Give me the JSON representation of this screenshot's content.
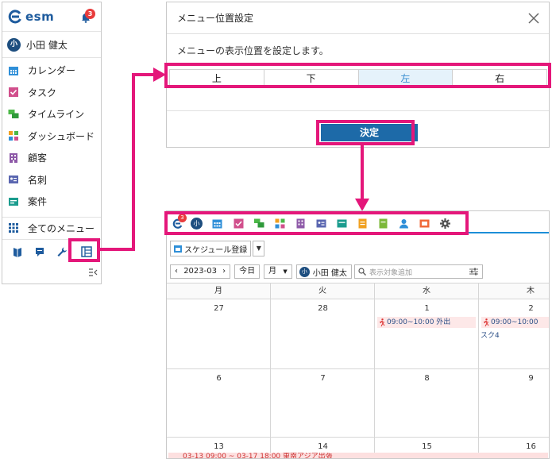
{
  "sidebar": {
    "logo": "esm",
    "notification_count": "3",
    "user": {
      "initial": "小",
      "name": "小田 健太"
    },
    "items": [
      {
        "label": "カレンダー",
        "icon": "calendar-icon",
        "color": "#2f8fd8"
      },
      {
        "label": "タスク",
        "icon": "task-icon",
        "color": "#d14f8c"
      },
      {
        "label": "タイムライン",
        "icon": "timeline-icon",
        "color": "#4cb848"
      },
      {
        "label": "ダッシュボード",
        "icon": "dashboard-icon",
        "color": "#f0a020"
      },
      {
        "label": "顧客",
        "icon": "customer-icon",
        "color": "#8e5aa8"
      },
      {
        "label": "名刺",
        "icon": "business-card-icon",
        "color": "#5a66b0"
      },
      {
        "label": "案件",
        "icon": "project-icon",
        "color": "#1b9c8e"
      }
    ],
    "all_menu": "全てのメニュー"
  },
  "dialog": {
    "title": "メニュー位置設定",
    "description": "メニューの表示位置を設定します。",
    "options": [
      "上",
      "下",
      "左",
      "右"
    ],
    "selected": "左",
    "confirm_label": "決定"
  },
  "calendar": {
    "badge": "3",
    "user_initial": "小",
    "schedule_button": "スケジュール登録",
    "month_value": "2023-03",
    "today_label": "今日",
    "view_label": "月",
    "user_name": "小田 健太",
    "search_placeholder": "表示対象追加",
    "weekdays": [
      "月",
      "火",
      "水",
      "木"
    ],
    "weeks": [
      {
        "days": [
          "27",
          "28",
          "1",
          "2"
        ]
      },
      {
        "days": [
          "6",
          "7",
          "8",
          "9"
        ]
      },
      {
        "days": [
          "13",
          "14",
          "15",
          "16"
        ]
      }
    ],
    "events": {
      "wed_1": "09:00~10:00 外出",
      "thu_2": "09:00~10:00",
      "thu_2_extra": "スク4",
      "long_event": "03-13 09:00 ~ 03-17 18:00 東南アジア出張"
    }
  },
  "colors": {
    "highlight": "#e4177a",
    "brand": "#1f5c9e",
    "accent_blue": "#1d8ed8",
    "confirm_button": "#1d6aa8"
  }
}
